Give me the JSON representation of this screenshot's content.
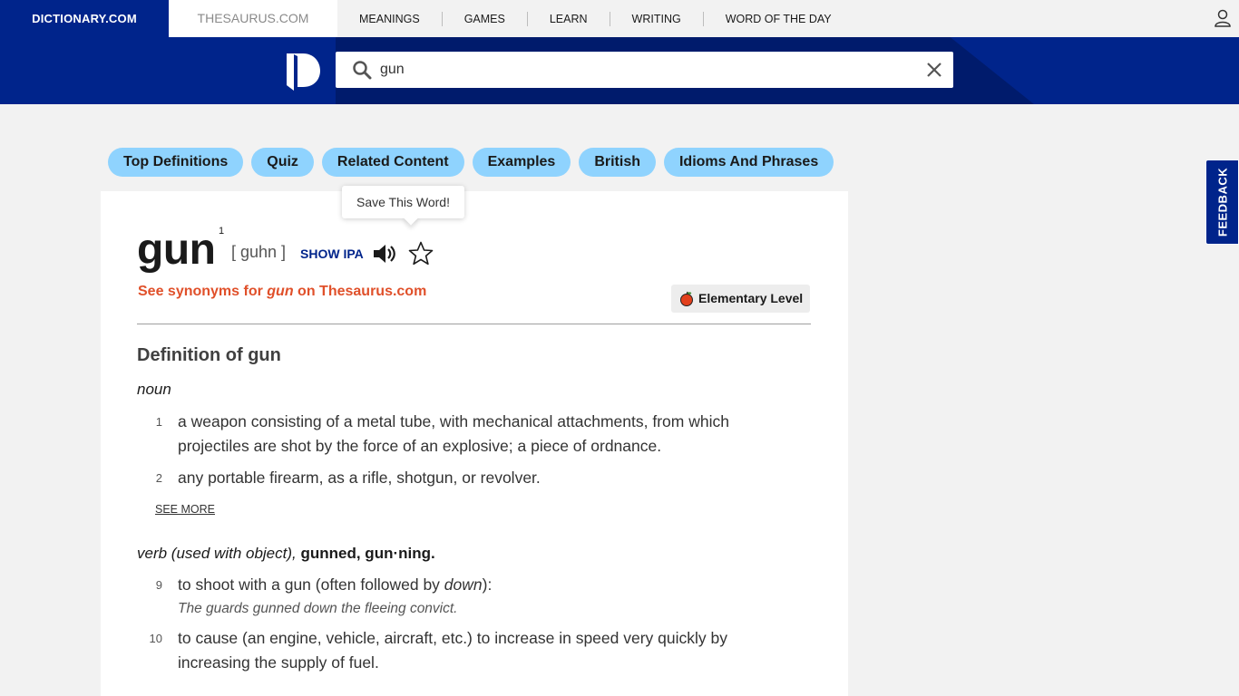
{
  "topbar": {
    "dictionary_tab": "DICTIONARY.COM",
    "thesaurus_tab": "THESAURUS.COM",
    "nav": [
      "MEANINGS",
      "GAMES",
      "LEARN",
      "WRITING",
      "WORD OF THE DAY"
    ]
  },
  "search": {
    "value": "gun"
  },
  "pills": [
    "Top Definitions",
    "Quiz",
    "Related Content",
    "Examples",
    "British",
    "Idioms And Phrases"
  ],
  "entry": {
    "tooltip": "Save This Word!",
    "headword": "gun",
    "superscript": "1",
    "pronunciation": "[ guhn ]",
    "show_ipa": "SHOW IPA",
    "synonyms_prefix": "See synonyms for ",
    "synonyms_word": "gun",
    "synonyms_suffix": " on Thesaurus.com",
    "level": "Elementary Level",
    "definition_title": "Definition of gun",
    "noun_label": "noun",
    "noun_defs": [
      {
        "num": "1",
        "text": "a weapon consisting of a metal tube, with mechanical attachments, from which projectiles are shot by the force of an explosive; a piece of ordnance."
      },
      {
        "num": "2",
        "text": "any portable firearm, as a rifle, shotgun, or revolver."
      }
    ],
    "see_more": "SEE MORE",
    "verb_label": "verb (used with object),",
    "verb_forms": "gunned, gun·ning.",
    "verb_defs": [
      {
        "num": "9",
        "text_a": "to shoot with a gun (often followed by ",
        "text_em": "down",
        "text_b": "):",
        "example": "The guards gunned down the fleeing convict."
      },
      {
        "num": "10",
        "text": "to cause (an engine, vehicle, aircraft, etc.) to increase in speed very quickly by increasing the supply of fuel."
      }
    ]
  },
  "feedback": "FEEDBACK",
  "colors": {
    "brand_blue": "#00248b",
    "pill_blue": "#8fd3fe",
    "synonym_orange": "#e0502a"
  }
}
